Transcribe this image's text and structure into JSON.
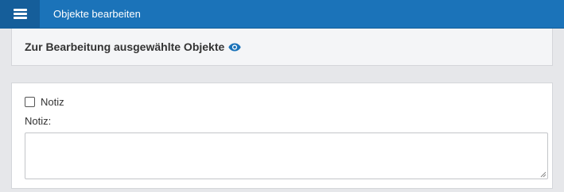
{
  "header": {
    "title": "Objekte bearbeiten",
    "menu_icon": "hamburger-menu-icon",
    "background": "#1b73b9"
  },
  "selection_panel": {
    "title": "Zur Bearbeitung ausgewählte Objekte",
    "icon": "eye-icon",
    "icon_color": "#1b73b9"
  },
  "form": {
    "checkbox_label": "Notiz",
    "checkbox_checked": false,
    "field_label": "Notiz:",
    "textarea_value": ""
  }
}
